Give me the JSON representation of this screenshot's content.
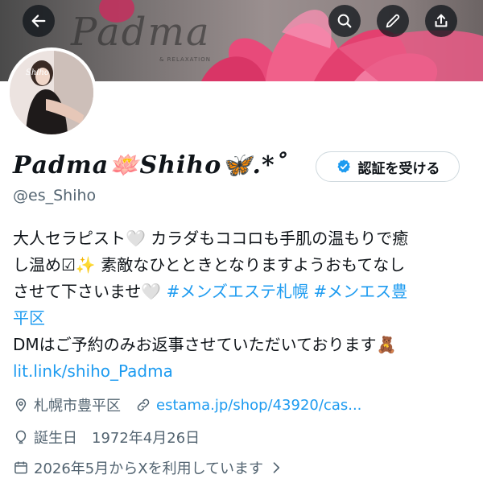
{
  "banner": {
    "word": "Padma",
    "sub": "& RELAXATION"
  },
  "toolbar": {
    "back_icon": "arrow-left-icon",
    "search_icon": "search-icon",
    "edit_icon": "pencil-icon",
    "share_icon": "share-icon"
  },
  "profile": {
    "display_name": "𝑷𝒂𝒅𝒎𝒂🪷𝑺𝒉𝒊𝒉𝒐🦋.*˚",
    "handle": "@es_Shiho",
    "verify_button": "認証を受ける"
  },
  "bio": {
    "line1": "大人セラピスト🤍 カラダもココロも手肌の温もりで癒",
    "line2": "し温め☑✨ 素敵なひとときとなりますようおもてなし",
    "line3_text": "させて下さいませ🤍 ",
    "tag1": "#メンズエステ札幌",
    "tag2": "#メンエス豊",
    "line4_tag": "平区",
    "line5": " DMはご予約のみお返事させていただいております🧸",
    "link": "lit.link/shiho_Padma"
  },
  "meta": {
    "location": "札幌市豊平区",
    "website": "estama.jp/shop/43920/cas...",
    "birthday_label": "誕生日",
    "birthday": "1972年4月26日",
    "joined": "2026年5月からXを利用しています"
  },
  "colors": {
    "accent": "#1d9bf0",
    "secondary_text": "#536471",
    "text": "#0f1419"
  }
}
